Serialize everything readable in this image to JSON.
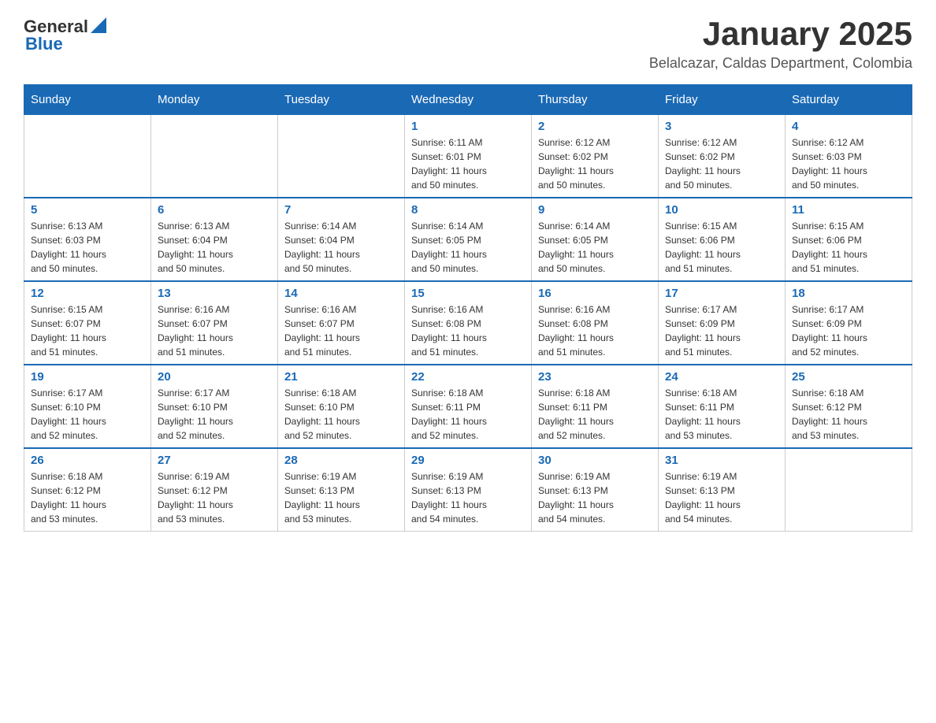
{
  "header": {
    "logo_general": "General",
    "logo_blue": "Blue",
    "title": "January 2025",
    "subtitle": "Belalcazar, Caldas Department, Colombia"
  },
  "days_of_week": [
    "Sunday",
    "Monday",
    "Tuesday",
    "Wednesday",
    "Thursday",
    "Friday",
    "Saturday"
  ],
  "weeks": [
    [
      {
        "day": "",
        "info": ""
      },
      {
        "day": "",
        "info": ""
      },
      {
        "day": "",
        "info": ""
      },
      {
        "day": "1",
        "info": "Sunrise: 6:11 AM\nSunset: 6:01 PM\nDaylight: 11 hours\nand 50 minutes."
      },
      {
        "day": "2",
        "info": "Sunrise: 6:12 AM\nSunset: 6:02 PM\nDaylight: 11 hours\nand 50 minutes."
      },
      {
        "day": "3",
        "info": "Sunrise: 6:12 AM\nSunset: 6:02 PM\nDaylight: 11 hours\nand 50 minutes."
      },
      {
        "day": "4",
        "info": "Sunrise: 6:12 AM\nSunset: 6:03 PM\nDaylight: 11 hours\nand 50 minutes."
      }
    ],
    [
      {
        "day": "5",
        "info": "Sunrise: 6:13 AM\nSunset: 6:03 PM\nDaylight: 11 hours\nand 50 minutes."
      },
      {
        "day": "6",
        "info": "Sunrise: 6:13 AM\nSunset: 6:04 PM\nDaylight: 11 hours\nand 50 minutes."
      },
      {
        "day": "7",
        "info": "Sunrise: 6:14 AM\nSunset: 6:04 PM\nDaylight: 11 hours\nand 50 minutes."
      },
      {
        "day": "8",
        "info": "Sunrise: 6:14 AM\nSunset: 6:05 PM\nDaylight: 11 hours\nand 50 minutes."
      },
      {
        "day": "9",
        "info": "Sunrise: 6:14 AM\nSunset: 6:05 PM\nDaylight: 11 hours\nand 50 minutes."
      },
      {
        "day": "10",
        "info": "Sunrise: 6:15 AM\nSunset: 6:06 PM\nDaylight: 11 hours\nand 51 minutes."
      },
      {
        "day": "11",
        "info": "Sunrise: 6:15 AM\nSunset: 6:06 PM\nDaylight: 11 hours\nand 51 minutes."
      }
    ],
    [
      {
        "day": "12",
        "info": "Sunrise: 6:15 AM\nSunset: 6:07 PM\nDaylight: 11 hours\nand 51 minutes."
      },
      {
        "day": "13",
        "info": "Sunrise: 6:16 AM\nSunset: 6:07 PM\nDaylight: 11 hours\nand 51 minutes."
      },
      {
        "day": "14",
        "info": "Sunrise: 6:16 AM\nSunset: 6:07 PM\nDaylight: 11 hours\nand 51 minutes."
      },
      {
        "day": "15",
        "info": "Sunrise: 6:16 AM\nSunset: 6:08 PM\nDaylight: 11 hours\nand 51 minutes."
      },
      {
        "day": "16",
        "info": "Sunrise: 6:16 AM\nSunset: 6:08 PM\nDaylight: 11 hours\nand 51 minutes."
      },
      {
        "day": "17",
        "info": "Sunrise: 6:17 AM\nSunset: 6:09 PM\nDaylight: 11 hours\nand 51 minutes."
      },
      {
        "day": "18",
        "info": "Sunrise: 6:17 AM\nSunset: 6:09 PM\nDaylight: 11 hours\nand 52 minutes."
      }
    ],
    [
      {
        "day": "19",
        "info": "Sunrise: 6:17 AM\nSunset: 6:10 PM\nDaylight: 11 hours\nand 52 minutes."
      },
      {
        "day": "20",
        "info": "Sunrise: 6:17 AM\nSunset: 6:10 PM\nDaylight: 11 hours\nand 52 minutes."
      },
      {
        "day": "21",
        "info": "Sunrise: 6:18 AM\nSunset: 6:10 PM\nDaylight: 11 hours\nand 52 minutes."
      },
      {
        "day": "22",
        "info": "Sunrise: 6:18 AM\nSunset: 6:11 PM\nDaylight: 11 hours\nand 52 minutes."
      },
      {
        "day": "23",
        "info": "Sunrise: 6:18 AM\nSunset: 6:11 PM\nDaylight: 11 hours\nand 52 minutes."
      },
      {
        "day": "24",
        "info": "Sunrise: 6:18 AM\nSunset: 6:11 PM\nDaylight: 11 hours\nand 53 minutes."
      },
      {
        "day": "25",
        "info": "Sunrise: 6:18 AM\nSunset: 6:12 PM\nDaylight: 11 hours\nand 53 minutes."
      }
    ],
    [
      {
        "day": "26",
        "info": "Sunrise: 6:18 AM\nSunset: 6:12 PM\nDaylight: 11 hours\nand 53 minutes."
      },
      {
        "day": "27",
        "info": "Sunrise: 6:19 AM\nSunset: 6:12 PM\nDaylight: 11 hours\nand 53 minutes."
      },
      {
        "day": "28",
        "info": "Sunrise: 6:19 AM\nSunset: 6:13 PM\nDaylight: 11 hours\nand 53 minutes."
      },
      {
        "day": "29",
        "info": "Sunrise: 6:19 AM\nSunset: 6:13 PM\nDaylight: 11 hours\nand 54 minutes."
      },
      {
        "day": "30",
        "info": "Sunrise: 6:19 AM\nSunset: 6:13 PM\nDaylight: 11 hours\nand 54 minutes."
      },
      {
        "day": "31",
        "info": "Sunrise: 6:19 AM\nSunset: 6:13 PM\nDaylight: 11 hours\nand 54 minutes."
      },
      {
        "day": "",
        "info": ""
      }
    ]
  ]
}
